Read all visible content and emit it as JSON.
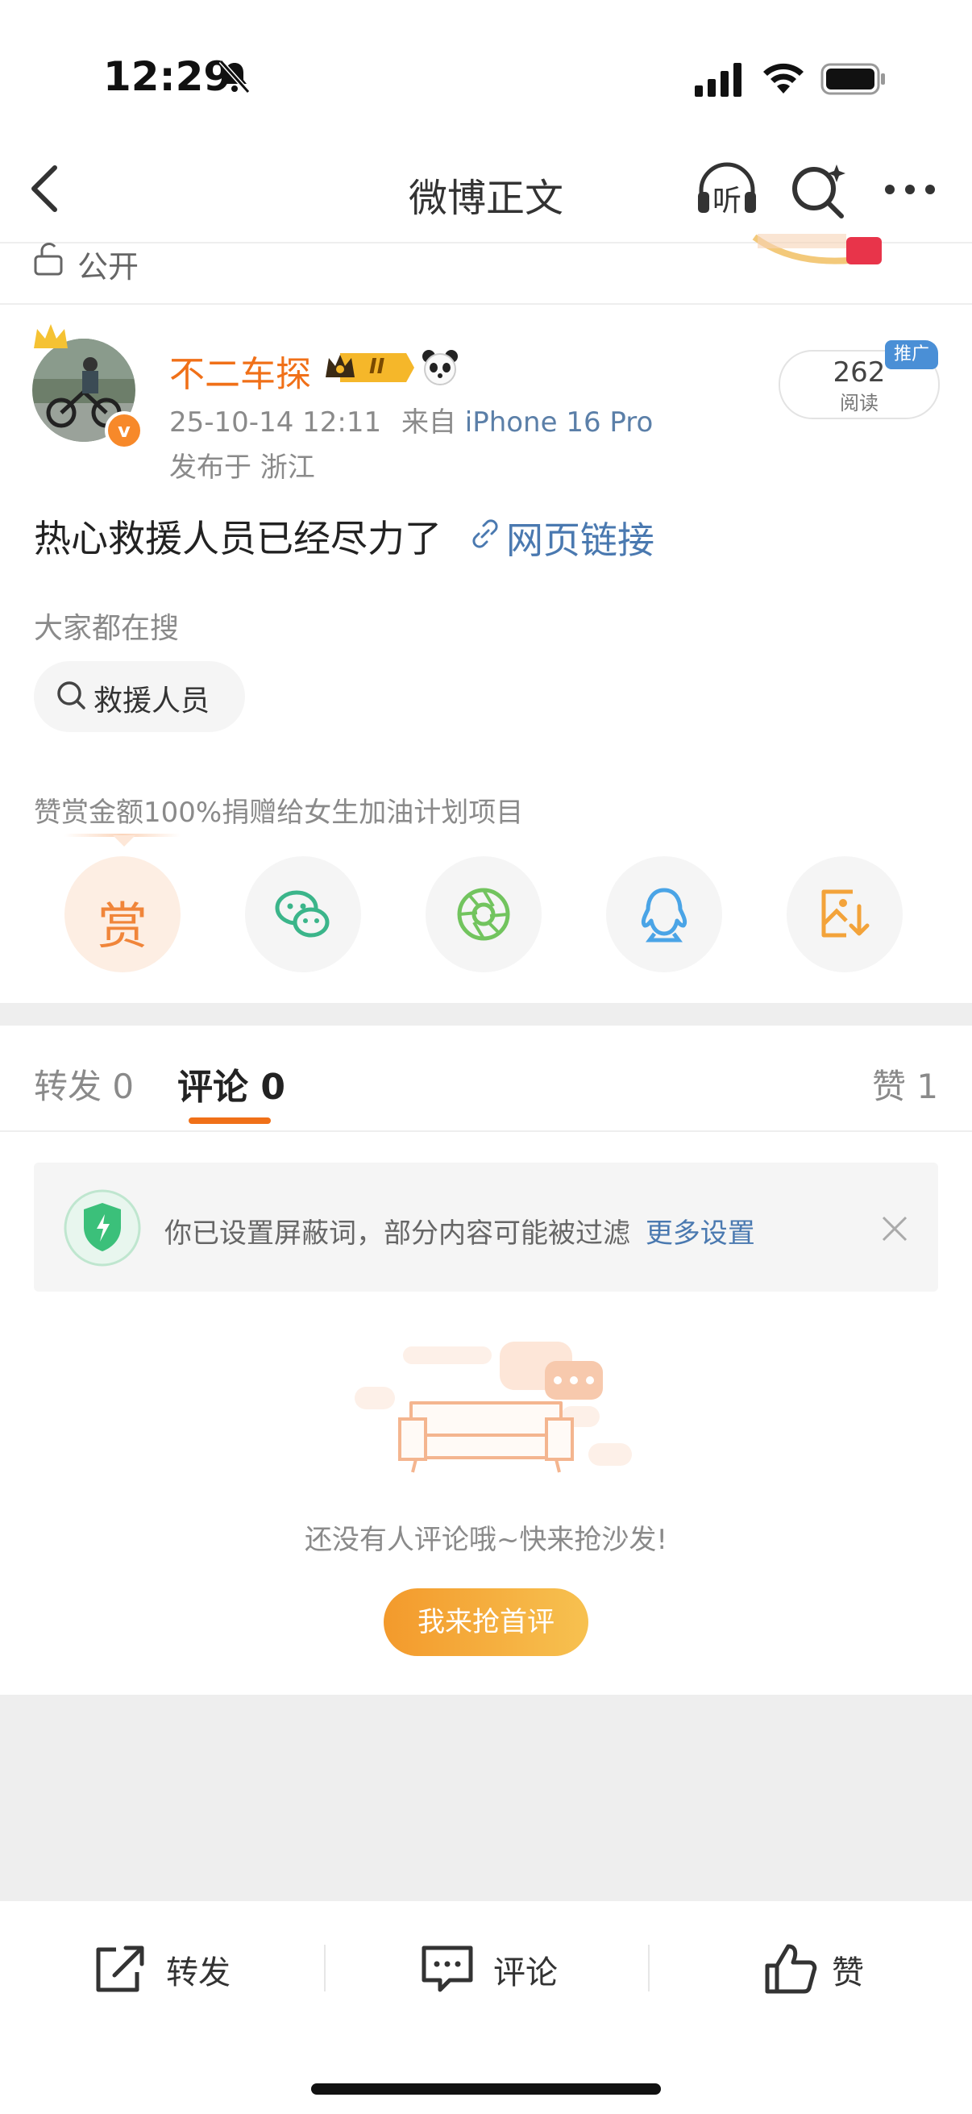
{
  "status_bar": {
    "time": "12:29"
  },
  "nav": {
    "title": "微博正文",
    "listen_label": "听"
  },
  "visibility": {
    "label": "公开"
  },
  "author": {
    "name": "不二车探",
    "verified_mark": "v",
    "vip_level": "II",
    "date": "25-10-14 12:11",
    "from_prefix": "来自",
    "source": "iPhone 16 Pro",
    "location": "发布于 浙江"
  },
  "read_stats": {
    "count": "262",
    "label": "阅读",
    "promo_tag": "推广"
  },
  "post": {
    "text": "热心救援人员已经尽力了",
    "link_text": "网页链接"
  },
  "hot_search": {
    "header": "大家都在搜",
    "chip": "救援人员"
  },
  "reward": {
    "note": "赞赏金额100%捐赠给女生加油计划项目",
    "reward_char": "赏"
  },
  "tabs": {
    "forward": "转发 0",
    "comment": "评论 0",
    "like": "赞 1"
  },
  "filter_notice": {
    "text": "你已设置屏蔽词，部分内容可能被过滤",
    "link": "更多设置"
  },
  "empty_state": {
    "text": "还没有人评论哦~快来抢沙发!",
    "button": "我来抢首评"
  },
  "toolbar": {
    "forward": "转发",
    "comment": "评论",
    "like": "赞"
  },
  "colors": {
    "accent_orange": "#f07018",
    "link_blue": "#4a79b0"
  }
}
